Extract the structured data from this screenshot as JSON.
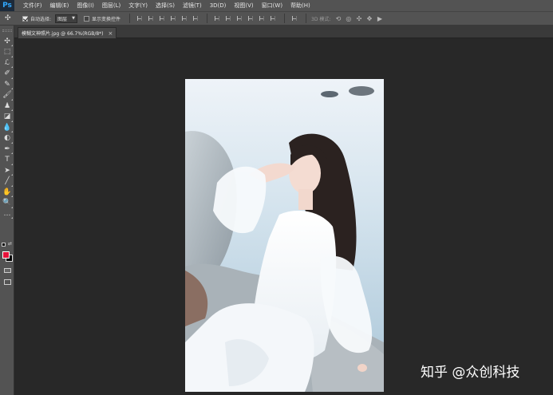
{
  "app": {
    "logo": "Ps"
  },
  "menu": [
    "文件(F)",
    "编辑(E)",
    "图像(I)",
    "图层(L)",
    "文字(Y)",
    "选择(S)",
    "滤镜(T)",
    "3D(D)",
    "视图(V)",
    "窗口(W)",
    "帮助(H)"
  ],
  "options": {
    "move_glyph": "✣",
    "auto_select_label": "自动选择:",
    "auto_select_checked": true,
    "auto_select_value": "图层",
    "show_transform_label": "显示变换控件",
    "show_transform_checked": false,
    "mode_label": "3D 模式:"
  },
  "document": {
    "tab_title": "模糊文神照片.jpg @ 66.7%(RGB/8*)",
    "close_glyph": "×"
  },
  "tools": [
    {
      "name": "move-tool-icon",
      "glyph": "✣"
    },
    {
      "name": "marquee-tool-icon",
      "glyph": "⬚"
    },
    {
      "name": "lasso-tool-icon",
      "glyph": "ℒ"
    },
    {
      "name": "quick-select-tool-icon",
      "glyph": "✐"
    },
    {
      "name": "crop-tool-icon",
      "glyph": "⌗"
    },
    {
      "name": "eyedropper-tool-icon",
      "glyph": "✎"
    },
    {
      "name": "healing-brush-tool-icon",
      "glyph": "✚"
    },
    {
      "name": "brush-tool-icon",
      "glyph": "🖌"
    },
    {
      "name": "clone-stamp-tool-icon",
      "glyph": "♟"
    },
    {
      "name": "history-brush-tool-icon",
      "glyph": "↺"
    },
    {
      "name": "eraser-tool-icon",
      "glyph": "◪"
    },
    {
      "name": "gradient-tool-icon",
      "glyph": "▥"
    },
    {
      "name": "blur-tool-icon",
      "glyph": "💧"
    },
    {
      "name": "dodge-tool-icon",
      "glyph": "◐"
    },
    {
      "name": "pen-tool-icon",
      "glyph": "✒"
    },
    {
      "name": "type-tool-icon",
      "glyph": "T"
    },
    {
      "name": "path-select-tool-icon",
      "glyph": "➤"
    },
    {
      "name": "line-tool-icon",
      "glyph": "╱"
    },
    {
      "name": "hand-tool-icon",
      "glyph": "✋"
    },
    {
      "name": "zoom-tool-icon",
      "glyph": "🔍"
    },
    {
      "name": "more-tools-icon",
      "glyph": "…"
    }
  ],
  "colors": {
    "foreground": "#e5123a",
    "background": "#000000",
    "accent": "#31a8ff"
  },
  "watermark": "知乎 @众创科技"
}
